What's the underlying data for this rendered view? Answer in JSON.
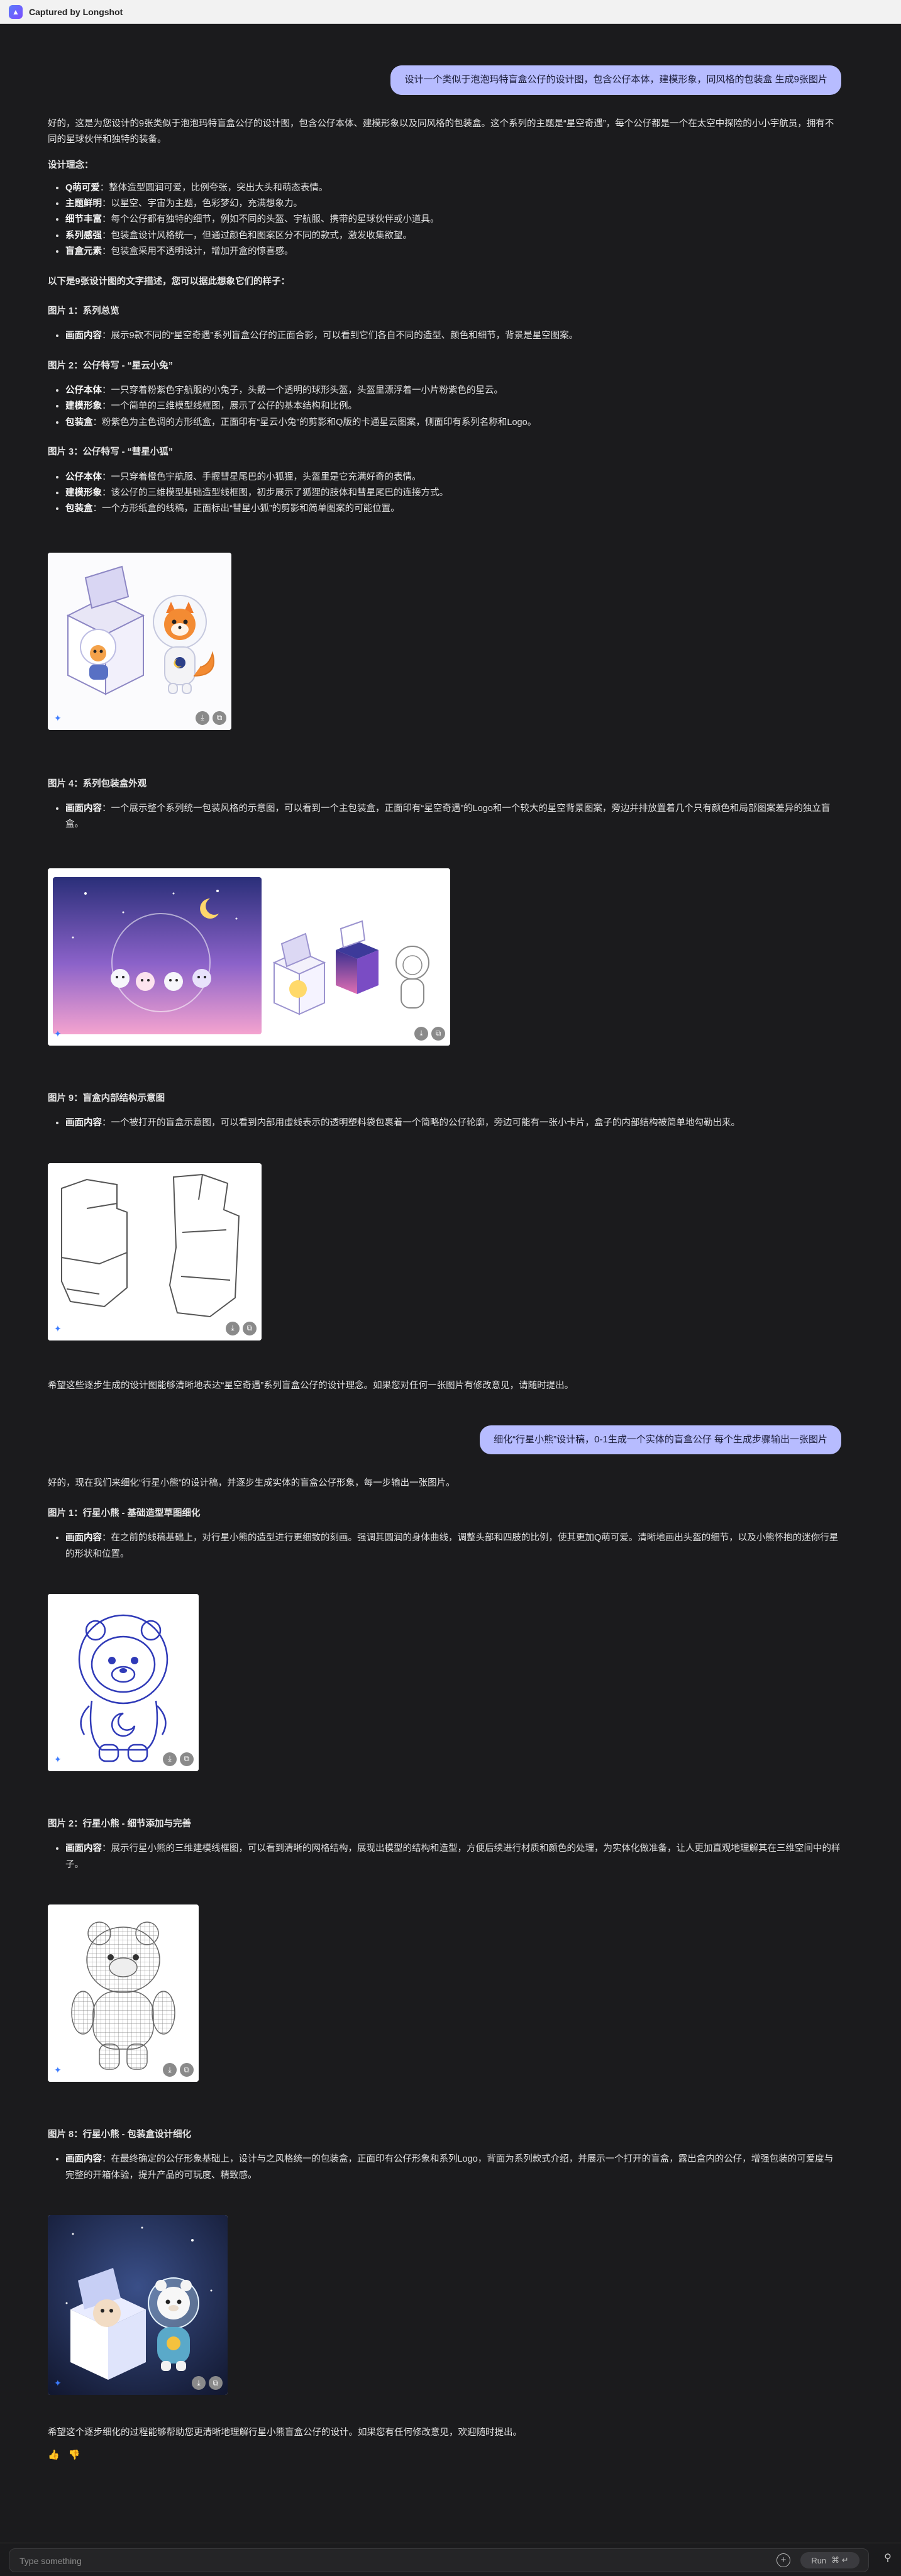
{
  "app": {
    "title": "Captured by Longshot"
  },
  "messages": {
    "user1": "设计一个类似于泡泡玛特盲盒公仔的设计图，包含公仔本体，建模形象，同风格的包装盒 生成9张图片",
    "intro": "好的，这是为您设计的9张类似于泡泡玛特盲盒公仔的设计图，包含公仔本体、建模形象以及同风格的包装盒。这个系列的主题是“星空奇遇”，每个公仔都是一个在太空中探险的小小宇航员，拥有不同的星球伙伴和独特的装备。",
    "concept_heading": "设计理念：",
    "concept": [
      {
        "k": "Q萌可爱",
        "v": "：整体造型圆润可爱，比例夸张，突出大头和萌态表情。"
      },
      {
        "k": "主题鲜明",
        "v": "：以星空、宇宙为主题，色彩梦幻，充满想象力。"
      },
      {
        "k": "细节丰富",
        "v": "：每个公仔都有独特的细节，例如不同的头盔、宇航服、携带的星球伙伴或小道具。"
      },
      {
        "k": "系列感强",
        "v": "：包装盒设计风格统一，但通过颜色和图案区分不同的款式，激发收集欲望。"
      },
      {
        "k": "盲盒元素",
        "v": "：包装盒采用不透明设计，增加开盒的惊喜感。"
      }
    ],
    "desc_intro": "以下是9张设计图的文字描述，您可以据此想象它们的样子：",
    "img1_h": "图片 1：系列总览",
    "img1": [
      {
        "k": "画面内容",
        "v": "：展示9款不同的“星空奇遇”系列盲盒公仔的正面合影，可以看到它们各自不同的造型、颜色和细节，背景是星空图案。"
      }
    ],
    "img2_h": "图片 2：公仔特写 - “星云小兔”",
    "img2": [
      {
        "k": "公仔本体",
        "v": "：一只穿着粉紫色宇航服的小兔子，头戴一个透明的球形头盔，头盔里漂浮着一小片粉紫色的星云。"
      },
      {
        "k": "建模形象",
        "v": "：一个简单的三维模型线框图，展示了公仔的基本结构和比例。"
      },
      {
        "k": "包装盒",
        "v": "：粉紫色为主色调的方形纸盒，正面印有“星云小兔”的剪影和Q版的卡通星云图案，侧面印有系列名称和Logo。"
      }
    ],
    "img3_h": "图片 3：公仔特写 - “彗星小狐”",
    "img3": [
      {
        "k": "公仔本体",
        "v": "：一只穿着橙色宇航服、手握彗星尾巴的小狐狸，头盔里是它充满好奇的表情。"
      },
      {
        "k": "建模形象",
        "v": "：该公仔的三维模型基础造型线框图，初步展示了狐狸的肢体和彗星尾巴的连接方式。"
      },
      {
        "k": "包装盒",
        "v": "：一个方形纸盒的线稿，正面标出“彗星小狐”的剪影和简单图案的可能位置。"
      }
    ],
    "img4_h": "图片 4：系列包装盒外观",
    "img4": [
      {
        "k": "画面内容",
        "v": "：一个展示整个系列统一包装风格的示意图，可以看到一个主包装盒，正面印有“星空奇遇”的Logo和一个较大的星空背景图案，旁边并排放置着几个只有颜色和局部图案差异的独立盲盒。"
      }
    ],
    "img9_h": "图片 9：盲盒内部结构示意图",
    "img9": [
      {
        "k": "画面内容",
        "v": "：一个被打开的盲盒示意图，可以看到内部用虚线表示的透明塑料袋包裹着一个简略的公仔轮廓，旁边可能有一张小卡片，盒子的内部结构被简单地勾勒出来。"
      }
    ],
    "closing1": "希望这些逐步生成的设计图能够清晰地表达“星空奇遇”系列盲盒公仔的设计理念。如果您对任何一张图片有修改意见，请随时提出。",
    "user2": "细化“行星小熊”设计稿，0-1生成一个实体的盲盒公仔 每个生成步骤输出一张图片",
    "reply2": "好的，现在我们来细化“行星小熊”的设计稿，并逐步生成实体的盲盒公仔形象，每一步输出一张图片。",
    "s1_h": "图片 1：行星小熊 - 基础造型草图细化",
    "s1": [
      {
        "k": "画面内容",
        "v": "：在之前的线稿基础上，对行星小熊的造型进行更细致的刻画。强调其圆润的身体曲线，调整头部和四肢的比例，使其更加Q萌可爱。清晰地画出头盔的细节，以及小熊怀抱的迷你行星的形状和位置。"
      }
    ],
    "s2_h": "图片 2：行星小熊 - 细节添加与完善",
    "s2": [
      {
        "k": "画面内容",
        "v": "：展示行星小熊的三维建模线框图，可以看到清晰的网格结构，展现出模型的结构和造型，方便后续进行材质和颜色的处理，为实体化做准备，让人更加直观地理解其在三维空间中的样子。"
      }
    ],
    "s8_h": "图片 8：行星小熊 - 包装盒设计细化",
    "s8": [
      {
        "k": "画面内容",
        "v": "：在最终确定的公仔形象基础上，设计与之风格统一的包装盒，正面印有公仔形象和系列Logo，背面为系列款式介绍，并展示一个打开的盲盒，露出盒内的公仔，增强包装的可爱度与完整的开箱体验，提升产品的可玩度、精致感。"
      }
    ],
    "closing2": "希望这个逐步细化的过程能够帮助您更清晰地理解行星小熊盲盒公仔的设计。如果您有任何修改意见，欢迎随时提出。"
  },
  "input": {
    "placeholder": "Type something",
    "run_label": "Run",
    "run_shortcut": "⌘ ↵"
  },
  "icons": {
    "copy": "⧉",
    "download": "⤓",
    "spark": "✦",
    "thumb_up": "👍",
    "thumb_down": "👎",
    "add": "+",
    "person": "⚲"
  },
  "colors": {
    "background": "#1b1b1d",
    "user_bubble": "#b7bcff",
    "accent": "#3b7bff"
  }
}
